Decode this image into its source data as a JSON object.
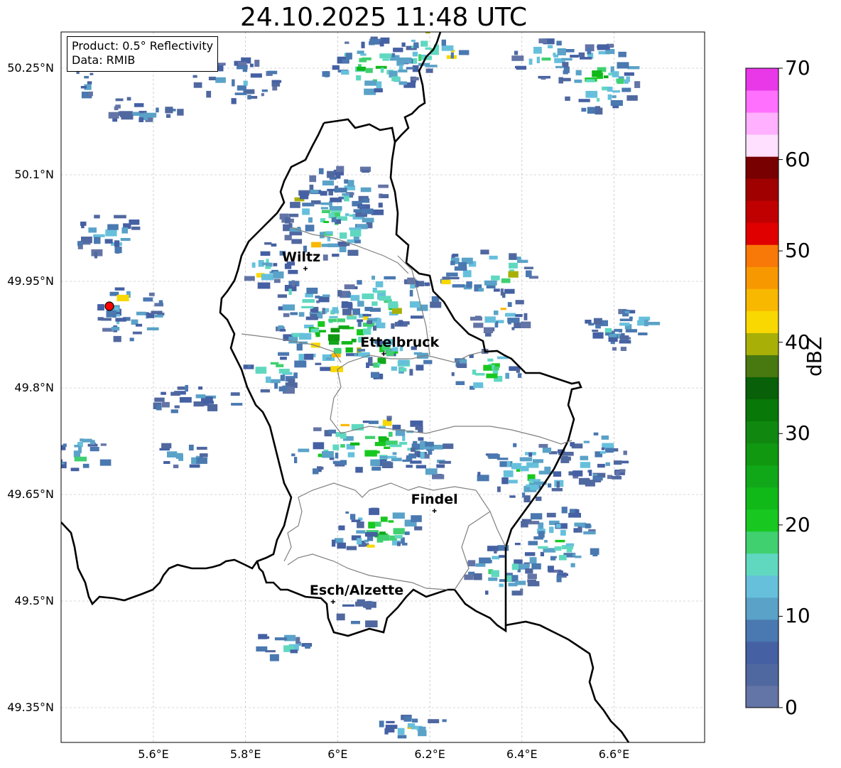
{
  "title": "24.10.2025 11:48 UTC",
  "info_box": {
    "product_line": "Product: 0.5° Reflectivity",
    "data_line": "Data: RMIB"
  },
  "map": {
    "lon_ticks": [
      {
        "value": 5.6,
        "label": "5.6°E"
      },
      {
        "value": 5.8,
        "label": "5.8°E"
      },
      {
        "value": 6.0,
        "label": "6°E"
      },
      {
        "value": 6.2,
        "label": "6.2°E"
      },
      {
        "value": 6.4,
        "label": "6.4°E"
      },
      {
        "value": 6.6,
        "label": "6.6°E"
      }
    ],
    "lat_ticks": [
      {
        "value": 50.25,
        "label": "50.25°N"
      },
      {
        "value": 50.1,
        "label": "50.1°N"
      },
      {
        "value": 49.95,
        "label": "49.95°N"
      },
      {
        "value": 49.8,
        "label": "49.8°N"
      },
      {
        "value": 49.65,
        "label": "49.65°N"
      },
      {
        "value": 49.5,
        "label": "49.5°N"
      },
      {
        "value": 49.35,
        "label": "49.35°N"
      }
    ],
    "cities": [
      {
        "name": "Wiltz",
        "lon": 5.93,
        "lat": 49.968
      },
      {
        "name": "Ettelbruck",
        "lon": 6.1,
        "lat": 49.848
      },
      {
        "name": "Findel",
        "lon": 6.21,
        "lat": 49.627
      },
      {
        "name": "Esch/Alzette",
        "lon": 5.99,
        "lat": 49.499
      }
    ],
    "radar_site": {
      "lon": 5.505,
      "lat": 49.914,
      "color": "#ff0000"
    },
    "border_color": "#000000",
    "district_color": "#808080",
    "grid": true
  },
  "colorbar": {
    "unit": "dBZ",
    "min": 0,
    "max": 70,
    "tick_labels": [
      "0",
      "10",
      "20",
      "30",
      "40",
      "50",
      "60",
      "70"
    ],
    "colors": [
      "#6374a6",
      "#5068a0",
      "#4560a3",
      "#4a78b0",
      "#5aa2c8",
      "#66c0dc",
      "#60d8c0",
      "#40d070",
      "#18c820",
      "#10b818",
      "#10a818",
      "#109810",
      "#108810",
      "#087808",
      "#086008",
      "#487810",
      "#a8b008",
      "#f8d800",
      "#f8b800",
      "#f89800",
      "#f87808",
      "#e00000",
      "#c00000",
      "#a00000",
      "#780000",
      "#ffe0ff",
      "#ffb0ff",
      "#ff70ff",
      "#e838e8"
    ]
  },
  "chart_data": {
    "type": "map",
    "title": "24.10.2025 11:48 UTC",
    "colorbar_label": "dBZ",
    "colorbar_range": [
      0,
      70
    ],
    "lon_range": [
      5.42,
      6.81
    ],
    "lat_range": [
      49.3,
      50.3
    ]
  }
}
